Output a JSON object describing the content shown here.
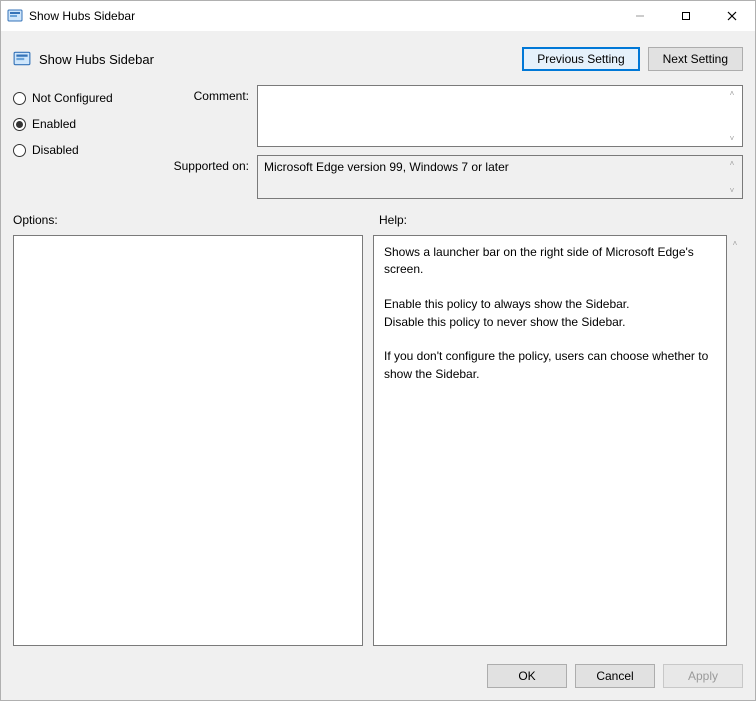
{
  "window": {
    "title": "Show Hubs Sidebar"
  },
  "policy": {
    "title": "Show Hubs Sidebar",
    "nav": {
      "previous_label": "Previous Setting",
      "next_label": "Next Setting"
    },
    "state": {
      "not_configured_label": "Not Configured",
      "enabled_label": "Enabled",
      "disabled_label": "Disabled",
      "selected": "Enabled"
    },
    "fields": {
      "comment_label": "Comment:",
      "comment_value": "",
      "supported_label": "Supported on:",
      "supported_value": "Microsoft Edge version 99, Windows 7 or later"
    },
    "sections": {
      "options_label": "Options:",
      "help_label": "Help:"
    },
    "help_text": "Shows a launcher bar on the right side of Microsoft Edge's screen.\n\nEnable this policy to always show the Sidebar.\nDisable this policy to never show the Sidebar.\n\nIf you don't configure the policy, users can choose whether to show the Sidebar."
  },
  "footer": {
    "ok_label": "OK",
    "cancel_label": "Cancel",
    "apply_label": "Apply"
  }
}
